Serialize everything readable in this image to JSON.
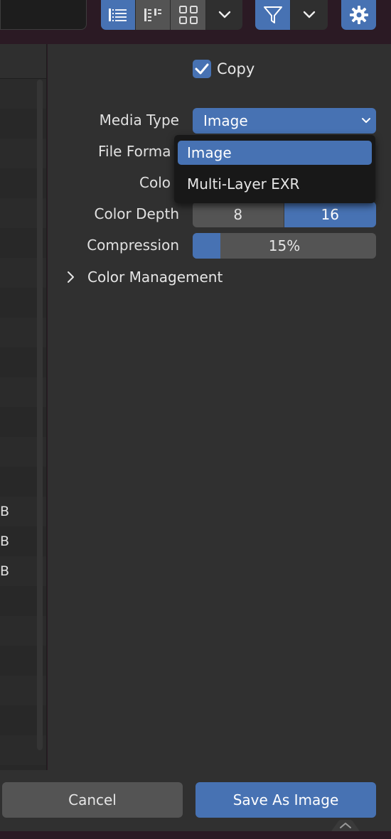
{
  "toolbar": {
    "view_buttons": [
      {
        "icon": "vertical-list-icon",
        "active": true
      },
      {
        "icon": "horizontal-list-icon",
        "active": false
      },
      {
        "icon": "thumbnails-icon",
        "active": false
      }
    ],
    "dropdown_icon": "chevron-down-icon",
    "filter_icon": "filter-icon",
    "settings_icon": "gear-icon"
  },
  "file_list": {
    "visible_partial_labels": [
      "B",
      "B",
      "B"
    ]
  },
  "settings": {
    "copy_label": "Copy",
    "copy_checked": true,
    "media_type": {
      "label": "Media Type",
      "value": "Image"
    },
    "file_format": {
      "label": "File Forma"
    },
    "color": {
      "label": "Colo"
    },
    "color_depth": {
      "label": "Color Depth",
      "options": [
        "8",
        "16"
      ],
      "selected": "16"
    },
    "compression": {
      "label": "Compression",
      "value": "15%",
      "fraction": 0.15
    },
    "color_management": {
      "label": "Color Management",
      "expanded": false
    }
  },
  "popup_menu": {
    "items": [
      {
        "label": "Image",
        "highlighted": true
      },
      {
        "label": "Multi-Layer EXR",
        "highlighted": false
      }
    ]
  },
  "buttons": {
    "cancel": "Cancel",
    "save": "Save As Image"
  },
  "colors": {
    "accent": "#4772b3",
    "panel": "#303030",
    "field": "#545454",
    "popup": "#181818"
  }
}
